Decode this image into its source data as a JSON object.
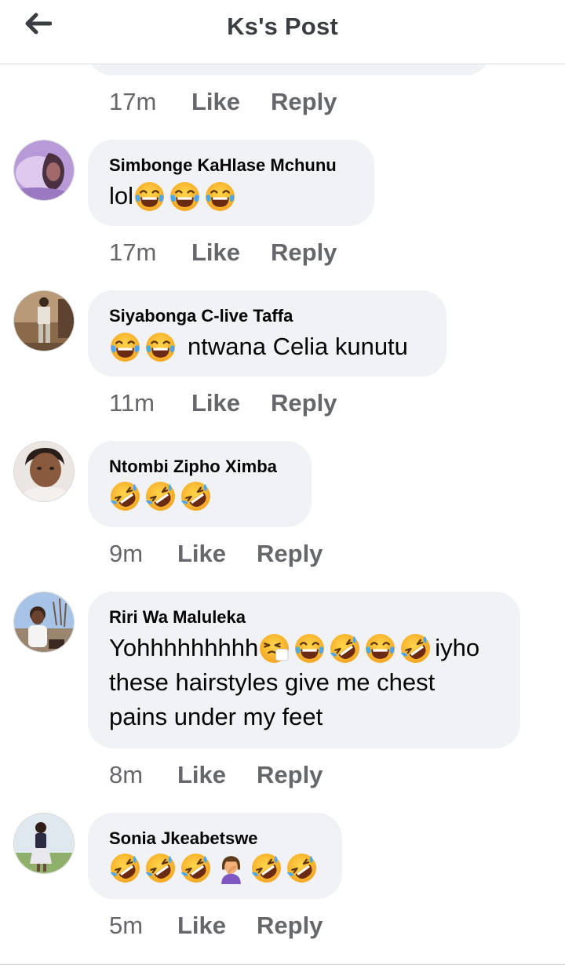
{
  "header": {
    "title": "Ks's Post",
    "back_icon": "arrow-left-icon"
  },
  "colors": {
    "bubble": "#f0f2f5",
    "meta": "#65676b",
    "title": "#3a3d42"
  },
  "previous_comment": {
    "time": "17m",
    "like_label": "Like",
    "reply_label": "Reply"
  },
  "comments": [
    {
      "author": "Simbonge KaHlase Mchunu",
      "text_before": "lol",
      "text_after": "",
      "time": "17m",
      "like_label": "Like",
      "reply_label": "Reply"
    },
    {
      "author": "Siyabonga C-live Taffa",
      "text_before": "",
      "text_after": "ntwana Celia kunutu",
      "time": "11m",
      "like_label": "Like",
      "reply_label": "Reply"
    },
    {
      "author": "Ntombi Zipho Ximba",
      "text_before": "",
      "text_after": "",
      "time": "9m",
      "like_label": "Like",
      "reply_label": "Reply"
    },
    {
      "author": "Riri Wa Maluleka",
      "text_before": "Yohhhhhhhhh",
      "text_after": "iyho",
      "line2": "these hairstyles give me chest",
      "line3": "pains under my feet",
      "time": "8m",
      "like_label": "Like",
      "reply_label": "Reply"
    },
    {
      "author": "Sonia Jkeabetswe",
      "text_before": "",
      "text_after": "",
      "time": "5m",
      "like_label": "Like",
      "reply_label": "Reply"
    }
  ]
}
